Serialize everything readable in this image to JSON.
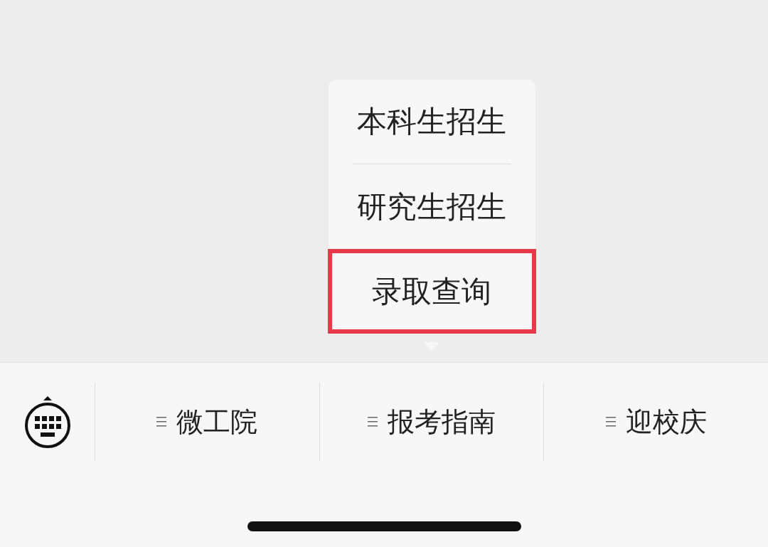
{
  "menu_bar": {
    "items": [
      {
        "label": "微工院"
      },
      {
        "label": "报考指南",
        "submenu": [
          {
            "label": "本科生招生",
            "highlighted": false
          },
          {
            "label": "研究生招生",
            "highlighted": false
          },
          {
            "label": "录取查询",
            "highlighted": true
          }
        ]
      },
      {
        "label": "迎校庆"
      }
    ]
  }
}
